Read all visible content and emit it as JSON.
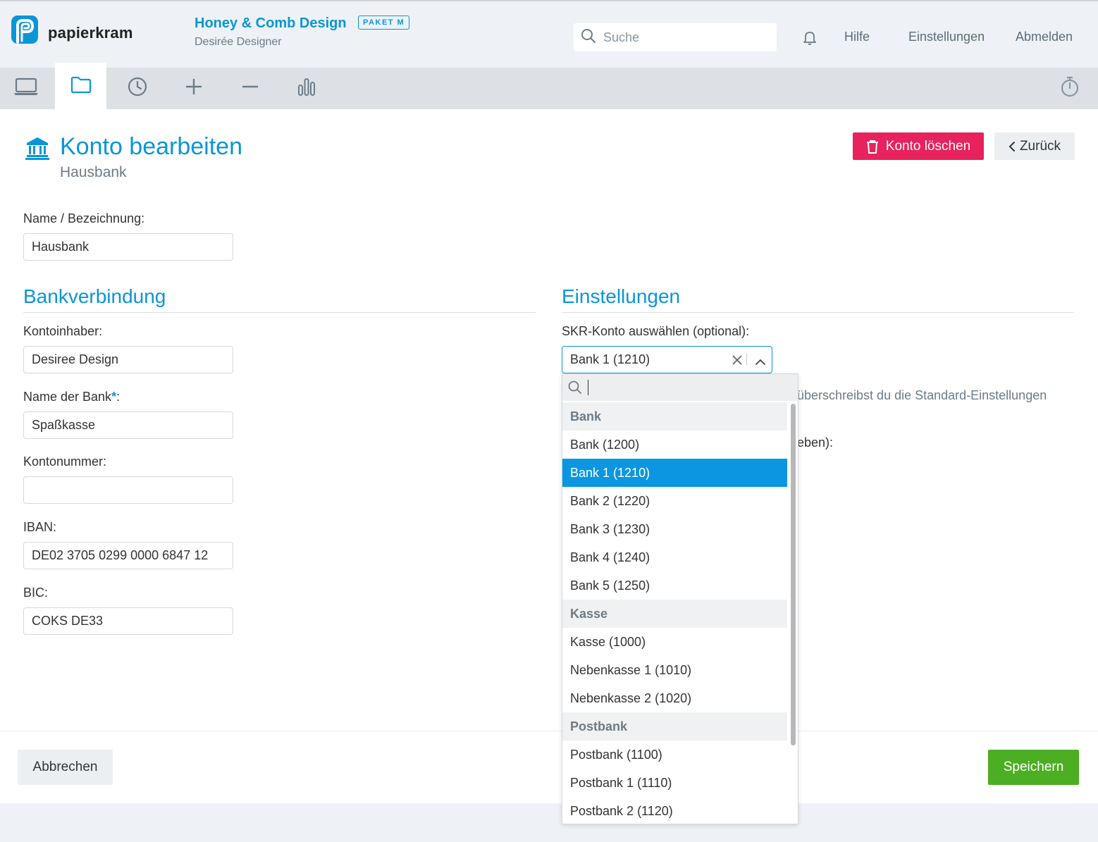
{
  "brand": {
    "name": "papierkram"
  },
  "company": {
    "name": "Honey & Comb Design",
    "plan": "PAKET M",
    "user": "Desirée Designer"
  },
  "search": {
    "placeholder": "Suche"
  },
  "topnav": {
    "help": "Hilfe",
    "settings": "Einstellungen",
    "logout": "Abmelden"
  },
  "toolbar": {
    "items": [
      "dashboard-icon",
      "folder-icon",
      "clock-icon",
      "plus-icon",
      "minus-icon",
      "bar-chart-icon"
    ],
    "active": "folder-icon",
    "right": "stopwatch-icon"
  },
  "page": {
    "title": "Konto bearbeiten",
    "subtitle": "Hausbank",
    "icon": "bank-icon",
    "delete_label": "Konto löschen",
    "back_label": "Zurück"
  },
  "form": {
    "name_label": "Name / Bezeichnung:",
    "name_value": "Hausbank",
    "bank_section": "Bankverbindung",
    "holder_label": "Kontoinhaber:",
    "holder_value": "Desiree Design",
    "bankname_label": "Name der Bank",
    "bankname_required": "*",
    "bankname_colon": ":",
    "bankname_value": "Spaßkasse",
    "accountno_label": "Kontonummer:",
    "accountno_value": "",
    "iban_label": "IBAN:",
    "iban_value": "DE02 3705 0299 0000 6847 12",
    "bic_label": "BIC:",
    "bic_value": "COKS DE33"
  },
  "settings": {
    "section": "Einstellungen",
    "skr_label": "SKR-Konto auswählen (optional):",
    "skr_selected": "Bank 1 (1210)",
    "hint_partial": "überschreibst du die Standard-Einstellungen",
    "label_partial": "eben):"
  },
  "dropdown": {
    "search_value": "",
    "groups": [
      {
        "label": "Bank",
        "options": [
          "Bank (1200)",
          "Bank 1 (1210)",
          "Bank 2 (1220)",
          "Bank 3 (1230)",
          "Bank 4 (1240)",
          "Bank 5 (1250)"
        ]
      },
      {
        "label": "Kasse",
        "options": [
          "Kasse (1000)",
          "Nebenkasse 1 (1010)",
          "Nebenkasse 2 (1020)"
        ]
      },
      {
        "label": "Postbank",
        "options": [
          "Postbank (1100)",
          "Postbank 1 (1110)",
          "Postbank 2 (1120)"
        ]
      }
    ]
  },
  "footer": {
    "cancel_label": "Abbrechen",
    "save_label": "Speichern"
  },
  "colors": {
    "accent": "#0a96d6",
    "danger": "#e8225c",
    "success": "#4cae22",
    "selected": "#0a96e0"
  }
}
